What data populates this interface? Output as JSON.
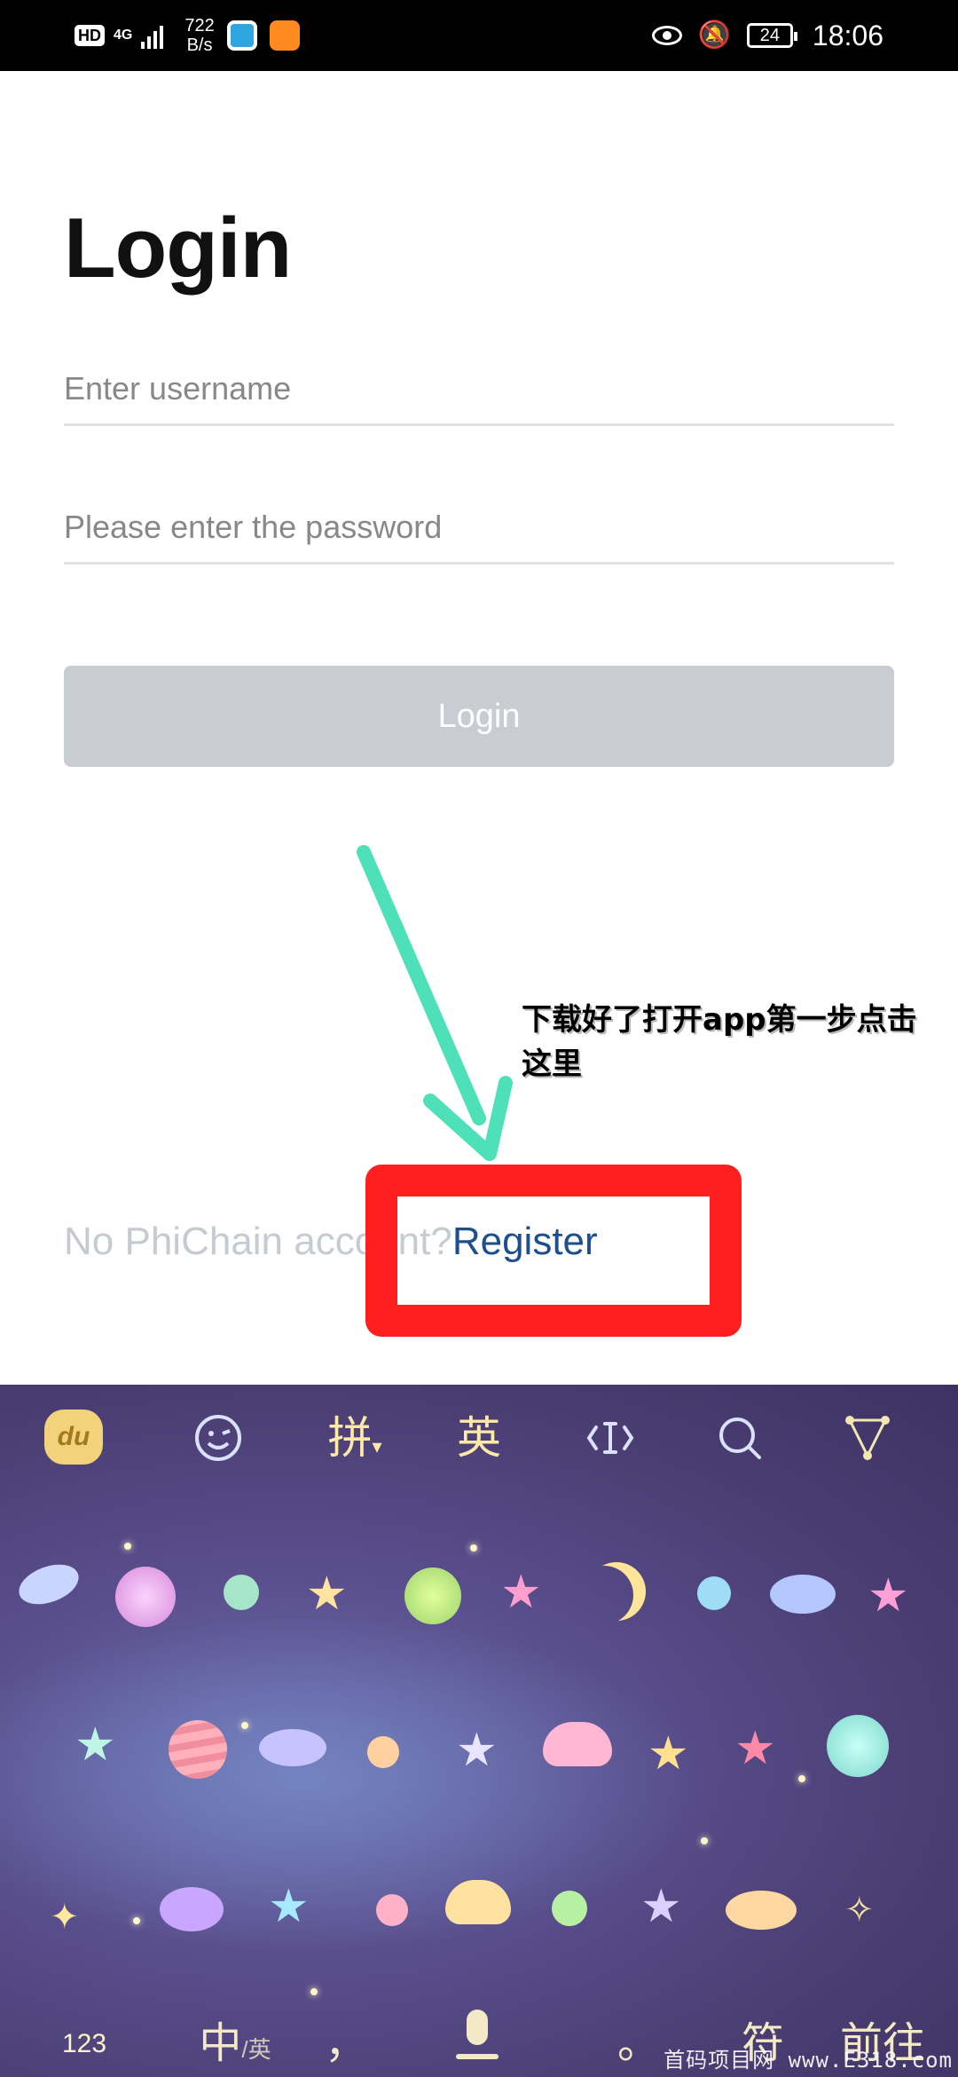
{
  "status_bar": {
    "hd": "HD",
    "network": "4G",
    "speed_value": "722",
    "speed_unit": "B/s",
    "battery": "24",
    "time": "18:06"
  },
  "login": {
    "title": "Login",
    "username_placeholder": "Enter username",
    "password_placeholder": "Please enter the password",
    "button_label": "Login",
    "no_account_text": "No PhiChain account?",
    "register_label": "Register"
  },
  "annotation": {
    "text": "下载好了打开app第一步点击这里",
    "arrow_color": "#4de0b9",
    "box_color": "#ff1f1f"
  },
  "keyboard": {
    "logo": "du",
    "pinyin_label": "拼",
    "english_label": "英",
    "key_123": "123",
    "key_zhong": "中",
    "key_zhong_sub": "/英",
    "key_comma": "，",
    "key_period": "。",
    "key_fu": "符",
    "key_go": "前往"
  },
  "watermark": "首码项目网 www.E318.com"
}
